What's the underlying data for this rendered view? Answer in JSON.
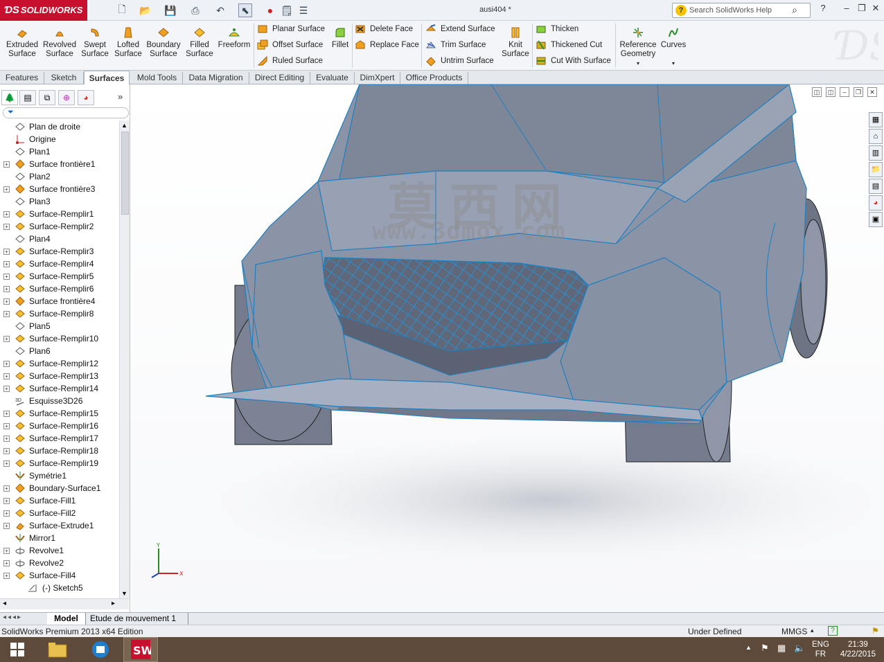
{
  "app": {
    "brand": "SOLIDWORKS",
    "doc_title": "ausi404 *",
    "search_placeholder": "Search SolidWorks Help"
  },
  "ribbon": {
    "extruded": "Extruded Surface",
    "revolved": "Revolved Surface",
    "swept": "Swept Surface",
    "lofted": "Lofted Surface",
    "boundary": "Boundary Surface",
    "filled": "Filled Surface",
    "freeform": "Freeform",
    "planar": "Planar Surface",
    "offset": "Offset Surface",
    "ruled": "Ruled Surface",
    "fillet": "Fillet",
    "delete_face": "Delete Face",
    "replace_face": "Replace Face",
    "extend": "Extend Surface",
    "trim": "Trim Surface",
    "untrim": "Untrim Surface",
    "knit": "Knit Surface",
    "thicken": "Thicken",
    "thickened_cut": "Thickened Cut",
    "cut_with_surface": "Cut With Surface",
    "reference_geometry": "Reference Geometry",
    "curves": "Curves"
  },
  "tabs": [
    "Features",
    "Sketch",
    "Surfaces",
    "Mold Tools",
    "Data Migration",
    "Direct Editing",
    "Evaluate",
    "DimXpert",
    "Office Products"
  ],
  "tree": [
    {
      "label": "Plan de droite",
      "type": "plane",
      "exp": false
    },
    {
      "label": "Origine",
      "type": "origin",
      "exp": false
    },
    {
      "label": "Plan1",
      "type": "plane",
      "exp": false
    },
    {
      "label": "Surface frontière1",
      "type": "boundary",
      "exp": true
    },
    {
      "label": "Plan2",
      "type": "plane",
      "exp": false
    },
    {
      "label": "Surface frontière3",
      "type": "boundary",
      "exp": true
    },
    {
      "label": "Plan3",
      "type": "plane",
      "exp": false
    },
    {
      "label": "Surface-Remplir1",
      "type": "fill",
      "exp": true
    },
    {
      "label": "Surface-Remplir2",
      "type": "fill",
      "exp": true
    },
    {
      "label": "Plan4",
      "type": "plane",
      "exp": false
    },
    {
      "label": "Surface-Remplir3",
      "type": "fill",
      "exp": true
    },
    {
      "label": "Surface-Remplir4",
      "type": "fill",
      "exp": true
    },
    {
      "label": "Surface-Remplir5",
      "type": "fill",
      "exp": true
    },
    {
      "label": "Surface-Remplir6",
      "type": "fill",
      "exp": true
    },
    {
      "label": "Surface frontière4",
      "type": "boundary",
      "exp": true
    },
    {
      "label": "Surface-Remplir8",
      "type": "fill",
      "exp": true
    },
    {
      "label": "Plan5",
      "type": "plane",
      "exp": false
    },
    {
      "label": "Surface-Remplir10",
      "type": "fill",
      "exp": true
    },
    {
      "label": "Plan6",
      "type": "plane",
      "exp": false
    },
    {
      "label": "Surface-Remplir12",
      "type": "fill",
      "exp": true
    },
    {
      "label": "Surface-Remplir13",
      "type": "fill",
      "exp": true
    },
    {
      "label": "Surface-Remplir14",
      "type": "fill",
      "exp": true
    },
    {
      "label": "Esquisse3D26",
      "type": "sketch3d",
      "exp": false
    },
    {
      "label": "Surface-Remplir15",
      "type": "fill",
      "exp": true
    },
    {
      "label": "Surface-Remplir16",
      "type": "fill",
      "exp": true
    },
    {
      "label": "Surface-Remplir17",
      "type": "fill",
      "exp": true
    },
    {
      "label": "Surface-Remplir18",
      "type": "fill",
      "exp": true
    },
    {
      "label": "Surface-Remplir19",
      "type": "fill",
      "exp": true
    },
    {
      "label": "Symétrie1",
      "type": "mirror",
      "exp": false
    },
    {
      "label": "Boundary-Surface1",
      "type": "boundary",
      "exp": true
    },
    {
      "label": "Surface-Fill1",
      "type": "fill",
      "exp": true
    },
    {
      "label": "Surface-Fill2",
      "type": "fill",
      "exp": true
    },
    {
      "label": "Surface-Extrude1",
      "type": "extrude",
      "exp": true
    },
    {
      "label": "Mirror1",
      "type": "mirror",
      "exp": false
    },
    {
      "label": "Revolve1",
      "type": "revolve",
      "exp": true
    },
    {
      "label": "Revolve2",
      "type": "revolve",
      "exp": true
    },
    {
      "label": "Surface-Fill4",
      "type": "fill",
      "exp": true
    },
    {
      "label": "(-) Sketch5",
      "type": "sketch",
      "exp": false,
      "child": true
    }
  ],
  "watermark": {
    "chars": "莫西网",
    "url": "www.3dmox.com"
  },
  "bottom_tabs": {
    "model": "Model",
    "motion": "Etude de mouvement 1"
  },
  "status": {
    "edition": "SolidWorks Premium 2013 x64 Edition",
    "state": "Under Defined",
    "units": "MMGS"
  },
  "taskbar": {
    "lang1": "ENG",
    "lang2": "FR",
    "time": "21:39",
    "date": "4/22/2015"
  },
  "colors": {
    "brand": "#c8102e",
    "edge": "#2a8fd0",
    "body": "#8a93a6"
  }
}
